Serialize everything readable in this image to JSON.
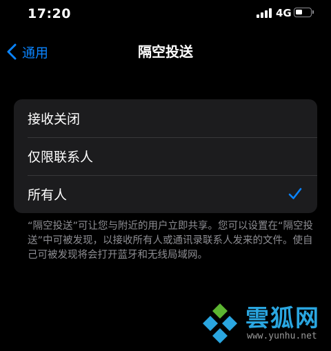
{
  "status_bar": {
    "time": "17:20",
    "network": "4G",
    "signal_bars": 4,
    "battery_level": 0.45,
    "icons": [
      "cellular-signal-icon",
      "battery-icon"
    ]
  },
  "nav": {
    "back_label": "通用",
    "back_icon": "chevron-left-icon",
    "title": "隔空投送"
  },
  "options": [
    {
      "label": "接收关闭",
      "selected": false
    },
    {
      "label": "仅限联系人",
      "selected": false
    },
    {
      "label": "所有人",
      "selected": true
    }
  ],
  "footer_text": "“隔空投送”可让您与附近的用户立即共享。您可以设置在“隔空投送”中可被发现，以接收所有人或通讯录联系人发来的文件。使自己可被发现将会打开蓝牙和无线局域网。",
  "watermark": {
    "brand": "雲狐网",
    "url": "www.yunhu.net"
  },
  "colors": {
    "background": "#000000",
    "group_background": "#1c1c1e",
    "accent": "#0a84ff",
    "secondary_text": "#8e8e93",
    "separator": "#38383a",
    "watermark_blue": "#2aa6e0",
    "watermark_green": "#5cb531"
  }
}
